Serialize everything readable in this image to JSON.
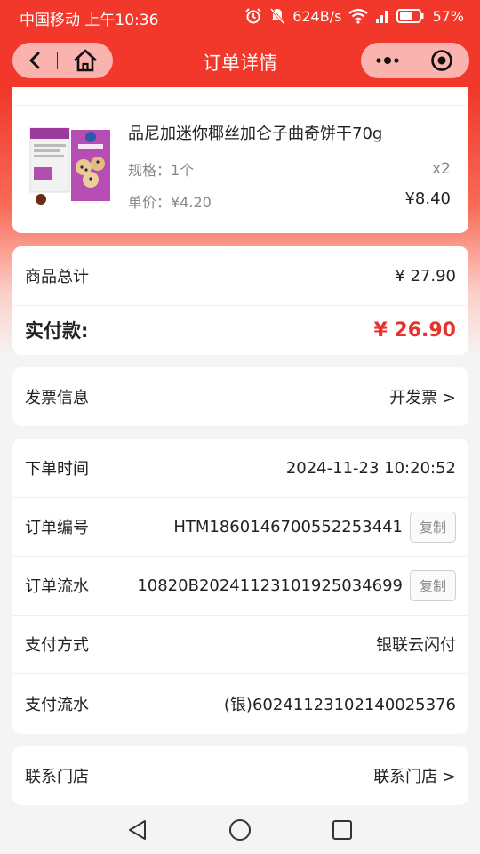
{
  "status_bar": {
    "carrier_time": "中国移动 上午10:36",
    "net_speed": "624B/s",
    "battery": "57%"
  },
  "nav": {
    "title": "订单详情"
  },
  "product": {
    "name": "品尼加迷你椰丝加仑子曲奇饼干70g",
    "spec": "规格：1个",
    "unit_price": "单价：¥4.20",
    "quantity": "x2",
    "subtotal": "¥8.40"
  },
  "summary": {
    "total_label": "商品总计",
    "total_value": "¥ 27.90",
    "paid_label": "实付款:",
    "paid_value": "¥ 26.90"
  },
  "invoice": {
    "label": "发票信息",
    "action": "开发票 >"
  },
  "order_info": {
    "time_label": "下单时间",
    "time_value": "2024-11-23 10:20:52",
    "number_label": "订单编号",
    "number_value": "HTM1860146700552253441",
    "flow_label": "订单流水",
    "flow_value": "10820B20241123101925034699",
    "pay_method_label": "支付方式",
    "pay_method_value": "银联云闪付",
    "pay_flow_label": "支付流水",
    "pay_flow_value": "(银)60241123102140025376",
    "copy_label": "复制"
  },
  "store": {
    "label": "联系门店",
    "action": "联系门店 >"
  },
  "colors": {
    "accent": "#f2372b",
    "price_red": "#e8322d"
  }
}
